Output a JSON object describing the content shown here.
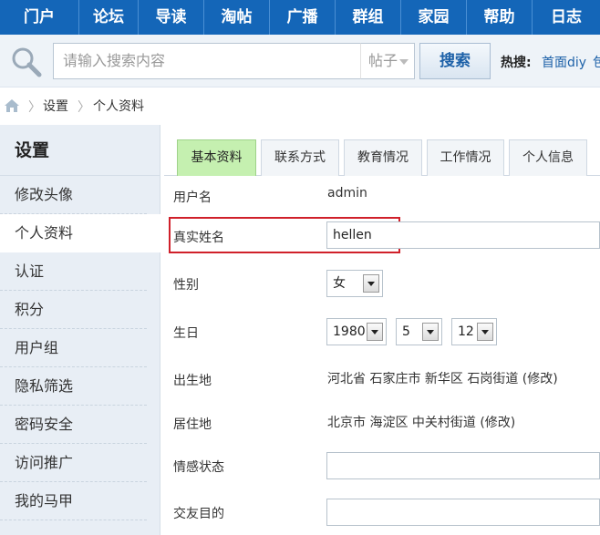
{
  "nav": {
    "items": [
      "门户",
      "论坛",
      "导读",
      "淘帖",
      "广播",
      "群组",
      "家园",
      "帮助",
      "日志"
    ]
  },
  "search": {
    "placeholder": "请输入搜索内容",
    "type": "帖子",
    "button": "搜索",
    "hot_label": "热搜:",
    "hot_link": "首面diy",
    "hot_link2": "包"
  },
  "breadcrumb": {
    "items": [
      "设置",
      "个人资料"
    ]
  },
  "sidebar": {
    "title": "设置",
    "items": [
      "修改头像",
      "个人资料",
      "认证",
      "积分",
      "用户组",
      "隐私筛选",
      "密码安全",
      "访问推广",
      "我的马甲"
    ]
  },
  "tabs": [
    "基本资料",
    "联系方式",
    "教育情况",
    "工作情况",
    "个人信息"
  ],
  "form": {
    "username_label": "用户名",
    "username": "admin",
    "realname_label": "真实姓名",
    "realname": "hellen",
    "gender_label": "性别",
    "gender": "女",
    "birthday_label": "生日",
    "birth_year": "1980",
    "birth_month": "5",
    "birth_day": "12",
    "birthplace_label": "出生地",
    "birthplace": "河北省 石家庄市 新华区 石岗街道 (修改)",
    "residence_label": "居住地",
    "residence": "北京市 海淀区 中关村街道 (修改)",
    "relationship_label": "情感状态",
    "relationship": "",
    "purpose_label": "交友目的",
    "purpose": ""
  },
  "colors": {
    "nav_bg": "#1466b8",
    "active_tab": "#c5f0b0",
    "highlight_border": "#d0202a"
  }
}
